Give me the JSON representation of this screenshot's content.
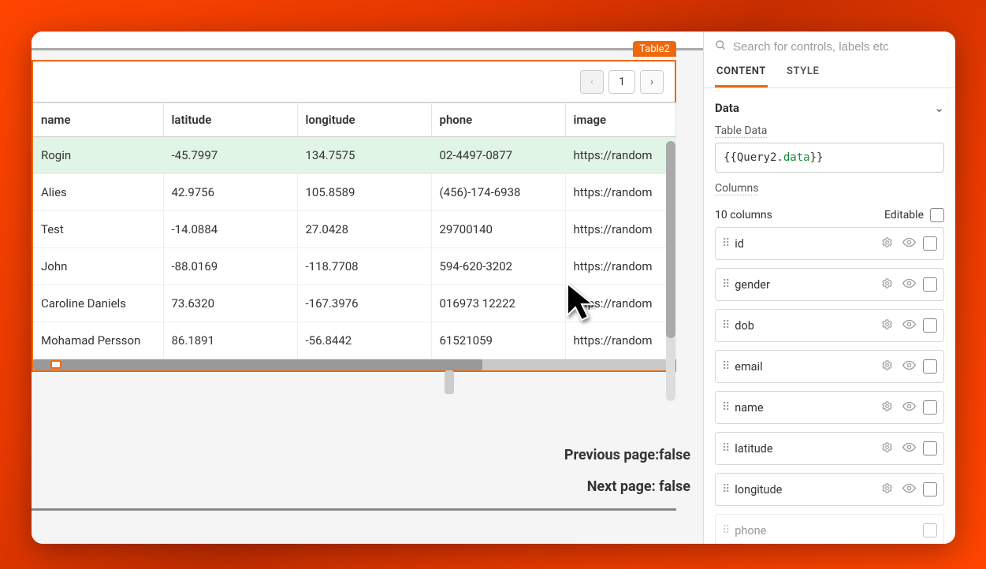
{
  "widget": {
    "badge": "Table2"
  },
  "toolbar": {
    "page_number": "1"
  },
  "table": {
    "headers": {
      "name": "name",
      "latitude": "latitude",
      "longitude": "longitude",
      "phone": "phone",
      "image": "image"
    },
    "rows": [
      {
        "name": "Rogin",
        "latitude": "-45.7997",
        "longitude": "134.7575",
        "phone": "02-4497-0877",
        "image": "https://random"
      },
      {
        "name": "Alies",
        "latitude": "42.9756",
        "longitude": "105.8589",
        "phone": "(456)-174-6938",
        "image": "https://random"
      },
      {
        "name": "Test",
        "latitude": "-14.0884",
        "longitude": "27.0428",
        "phone": "29700140",
        "image": "https://random"
      },
      {
        "name": "John",
        "latitude": "-88.0169",
        "longitude": "-118.7708",
        "phone": "594-620-3202",
        "image": "https://random"
      },
      {
        "name": "Caroline Daniels",
        "latitude": "73.6320",
        "longitude": "-167.3976",
        "phone": "016973 12222",
        "image": "https://random"
      },
      {
        "name": "Mohamad Persson",
        "latitude": "86.1891",
        "longitude": "-56.8442",
        "phone": "61521059",
        "image": "https://random"
      }
    ]
  },
  "status": {
    "prev": "Previous page:false",
    "next": "Next page: false"
  },
  "sidebar": {
    "search_placeholder": "Search for controls, labels etc",
    "tabs": {
      "content": "CONTENT",
      "style": "STYLE"
    },
    "section_data": "Data",
    "table_data_label": "Table Data",
    "table_data_expr_open": "{{",
    "table_data_expr_obj": "Query2.",
    "table_data_expr_prop": "data",
    "table_data_expr_close": "}}",
    "columns_label": "Columns",
    "columns_count": "10 columns",
    "editable_label": "Editable",
    "columns": [
      {
        "name": "id"
      },
      {
        "name": "gender"
      },
      {
        "name": "dob"
      },
      {
        "name": "email"
      },
      {
        "name": "name"
      },
      {
        "name": "latitude"
      },
      {
        "name": "longitude"
      },
      {
        "name": "phone"
      }
    ]
  }
}
